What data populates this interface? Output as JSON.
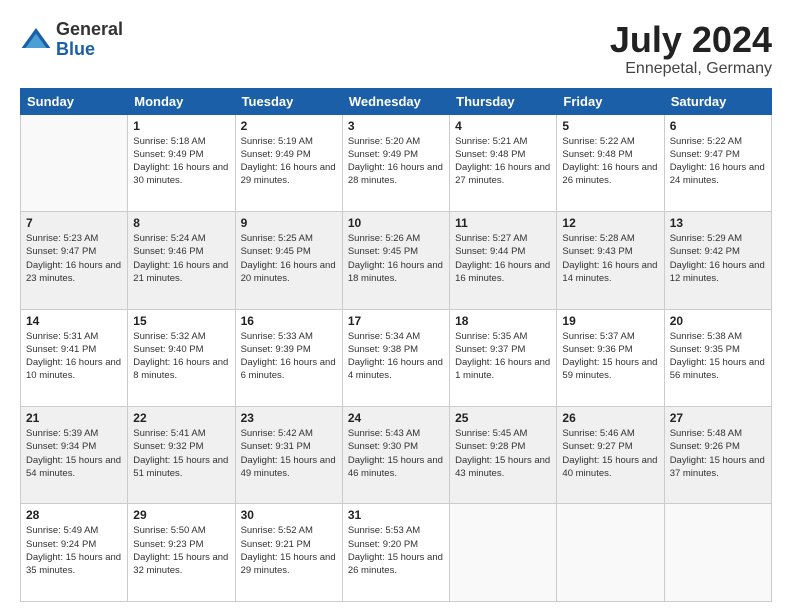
{
  "logo": {
    "general": "General",
    "blue": "Blue"
  },
  "title": {
    "month_year": "July 2024",
    "location": "Ennepetal, Germany"
  },
  "days_of_week": [
    "Sunday",
    "Monday",
    "Tuesday",
    "Wednesday",
    "Thursday",
    "Friday",
    "Saturday"
  ],
  "weeks": [
    [
      {
        "day": "",
        "sunrise": "",
        "sunset": "",
        "daylight": "",
        "empty": true
      },
      {
        "day": "1",
        "sunrise": "Sunrise: 5:18 AM",
        "sunset": "Sunset: 9:49 PM",
        "daylight": "Daylight: 16 hours and 30 minutes."
      },
      {
        "day": "2",
        "sunrise": "Sunrise: 5:19 AM",
        "sunset": "Sunset: 9:49 PM",
        "daylight": "Daylight: 16 hours and 29 minutes."
      },
      {
        "day": "3",
        "sunrise": "Sunrise: 5:20 AM",
        "sunset": "Sunset: 9:49 PM",
        "daylight": "Daylight: 16 hours and 28 minutes."
      },
      {
        "day": "4",
        "sunrise": "Sunrise: 5:21 AM",
        "sunset": "Sunset: 9:48 PM",
        "daylight": "Daylight: 16 hours and 27 minutes."
      },
      {
        "day": "5",
        "sunrise": "Sunrise: 5:22 AM",
        "sunset": "Sunset: 9:48 PM",
        "daylight": "Daylight: 16 hours and 26 minutes."
      },
      {
        "day": "6",
        "sunrise": "Sunrise: 5:22 AM",
        "sunset": "Sunset: 9:47 PM",
        "daylight": "Daylight: 16 hours and 24 minutes."
      }
    ],
    [
      {
        "day": "7",
        "sunrise": "Sunrise: 5:23 AM",
        "sunset": "Sunset: 9:47 PM",
        "daylight": "Daylight: 16 hours and 23 minutes."
      },
      {
        "day": "8",
        "sunrise": "Sunrise: 5:24 AM",
        "sunset": "Sunset: 9:46 PM",
        "daylight": "Daylight: 16 hours and 21 minutes."
      },
      {
        "day": "9",
        "sunrise": "Sunrise: 5:25 AM",
        "sunset": "Sunset: 9:45 PM",
        "daylight": "Daylight: 16 hours and 20 minutes."
      },
      {
        "day": "10",
        "sunrise": "Sunrise: 5:26 AM",
        "sunset": "Sunset: 9:45 PM",
        "daylight": "Daylight: 16 hours and 18 minutes."
      },
      {
        "day": "11",
        "sunrise": "Sunrise: 5:27 AM",
        "sunset": "Sunset: 9:44 PM",
        "daylight": "Daylight: 16 hours and 16 minutes."
      },
      {
        "day": "12",
        "sunrise": "Sunrise: 5:28 AM",
        "sunset": "Sunset: 9:43 PM",
        "daylight": "Daylight: 16 hours and 14 minutes."
      },
      {
        "day": "13",
        "sunrise": "Sunrise: 5:29 AM",
        "sunset": "Sunset: 9:42 PM",
        "daylight": "Daylight: 16 hours and 12 minutes."
      }
    ],
    [
      {
        "day": "14",
        "sunrise": "Sunrise: 5:31 AM",
        "sunset": "Sunset: 9:41 PM",
        "daylight": "Daylight: 16 hours and 10 minutes."
      },
      {
        "day": "15",
        "sunrise": "Sunrise: 5:32 AM",
        "sunset": "Sunset: 9:40 PM",
        "daylight": "Daylight: 16 hours and 8 minutes."
      },
      {
        "day": "16",
        "sunrise": "Sunrise: 5:33 AM",
        "sunset": "Sunset: 9:39 PM",
        "daylight": "Daylight: 16 hours and 6 minutes."
      },
      {
        "day": "17",
        "sunrise": "Sunrise: 5:34 AM",
        "sunset": "Sunset: 9:38 PM",
        "daylight": "Daylight: 16 hours and 4 minutes."
      },
      {
        "day": "18",
        "sunrise": "Sunrise: 5:35 AM",
        "sunset": "Sunset: 9:37 PM",
        "daylight": "Daylight: 16 hours and 1 minute."
      },
      {
        "day": "19",
        "sunrise": "Sunrise: 5:37 AM",
        "sunset": "Sunset: 9:36 PM",
        "daylight": "Daylight: 15 hours and 59 minutes."
      },
      {
        "day": "20",
        "sunrise": "Sunrise: 5:38 AM",
        "sunset": "Sunset: 9:35 PM",
        "daylight": "Daylight: 15 hours and 56 minutes."
      }
    ],
    [
      {
        "day": "21",
        "sunrise": "Sunrise: 5:39 AM",
        "sunset": "Sunset: 9:34 PM",
        "daylight": "Daylight: 15 hours and 54 minutes."
      },
      {
        "day": "22",
        "sunrise": "Sunrise: 5:41 AM",
        "sunset": "Sunset: 9:32 PM",
        "daylight": "Daylight: 15 hours and 51 minutes."
      },
      {
        "day": "23",
        "sunrise": "Sunrise: 5:42 AM",
        "sunset": "Sunset: 9:31 PM",
        "daylight": "Daylight: 15 hours and 49 minutes."
      },
      {
        "day": "24",
        "sunrise": "Sunrise: 5:43 AM",
        "sunset": "Sunset: 9:30 PM",
        "daylight": "Daylight: 15 hours and 46 minutes."
      },
      {
        "day": "25",
        "sunrise": "Sunrise: 5:45 AM",
        "sunset": "Sunset: 9:28 PM",
        "daylight": "Daylight: 15 hours and 43 minutes."
      },
      {
        "day": "26",
        "sunrise": "Sunrise: 5:46 AM",
        "sunset": "Sunset: 9:27 PM",
        "daylight": "Daylight: 15 hours and 40 minutes."
      },
      {
        "day": "27",
        "sunrise": "Sunrise: 5:48 AM",
        "sunset": "Sunset: 9:26 PM",
        "daylight": "Daylight: 15 hours and 37 minutes."
      }
    ],
    [
      {
        "day": "28",
        "sunrise": "Sunrise: 5:49 AM",
        "sunset": "Sunset: 9:24 PM",
        "daylight": "Daylight: 15 hours and 35 minutes."
      },
      {
        "day": "29",
        "sunrise": "Sunrise: 5:50 AM",
        "sunset": "Sunset: 9:23 PM",
        "daylight": "Daylight: 15 hours and 32 minutes."
      },
      {
        "day": "30",
        "sunrise": "Sunrise: 5:52 AM",
        "sunset": "Sunset: 9:21 PM",
        "daylight": "Daylight: 15 hours and 29 minutes."
      },
      {
        "day": "31",
        "sunrise": "Sunrise: 5:53 AM",
        "sunset": "Sunset: 9:20 PM",
        "daylight": "Daylight: 15 hours and 26 minutes."
      },
      {
        "day": "",
        "sunrise": "",
        "sunset": "",
        "daylight": "",
        "empty": true
      },
      {
        "day": "",
        "sunrise": "",
        "sunset": "",
        "daylight": "",
        "empty": true
      },
      {
        "day": "",
        "sunrise": "",
        "sunset": "",
        "daylight": "",
        "empty": true
      }
    ]
  ]
}
